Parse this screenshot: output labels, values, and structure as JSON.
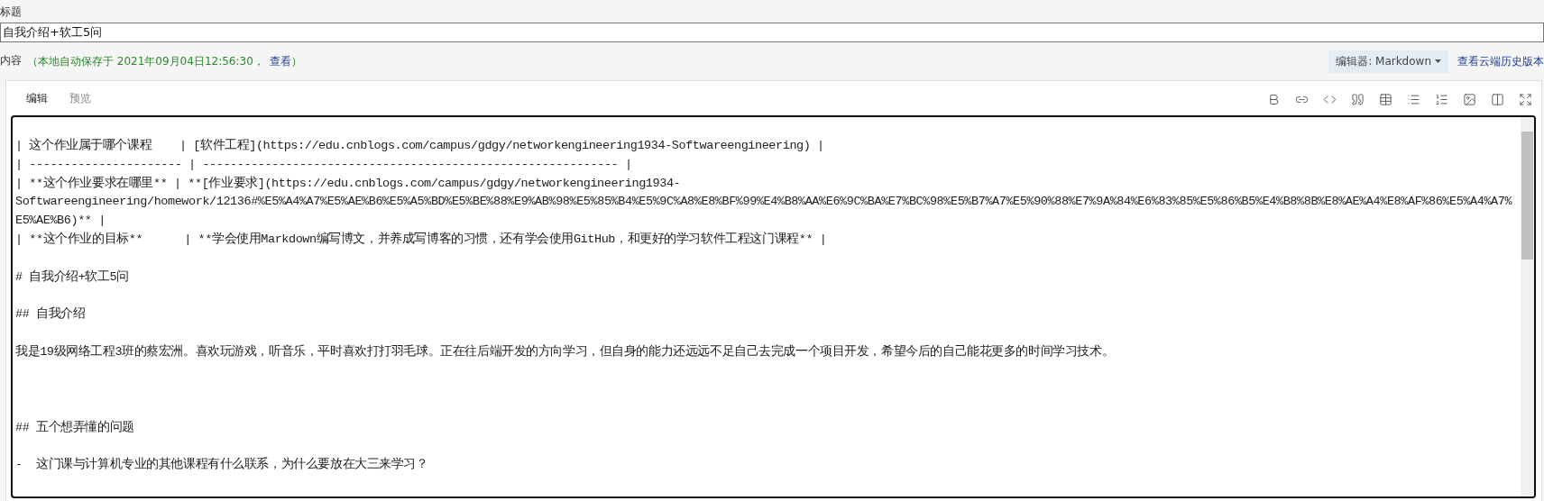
{
  "title_field": {
    "label": "标题",
    "value": "自我介绍+软工5问"
  },
  "content_header": {
    "label": "内容",
    "autosave_note": "（本地自动保存于 2021年09月04日12:56:30，",
    "view_link": "查看",
    "note_end": "）",
    "editor_menu": "编辑器: Markdown",
    "history_link": "查看云端历史版本"
  },
  "tabs": [
    {
      "label": "编辑",
      "selected": true
    },
    {
      "label": "预览",
      "selected": false
    }
  ],
  "toolbar": [
    {
      "kind": "bold"
    },
    {
      "kind": "link"
    },
    {
      "kind": "code"
    },
    {
      "kind": "quote"
    },
    {
      "kind": "table"
    },
    {
      "kind": "list"
    },
    {
      "kind": "ordered-list"
    },
    {
      "kind": "image"
    },
    {
      "kind": "split-view"
    },
    {
      "kind": "fullscreen"
    }
  ],
  "editor": {
    "lines": [
      {
        "kind": "blank"
      },
      {
        "kind": "text",
        "text": "| 这个作业属于哪个课程    | [软件工程](https://edu.cnblogs.com/campus/gdgy/networkengineering1934-Softwareengineering) |"
      },
      {
        "kind": "text",
        "text": "| ---------------------- | ------------------------------------------------------------ |"
      },
      {
        "kind": "text",
        "text": "| **这个作业要求在哪里** | **[作业要求](https://edu.cnblogs.com/campus/gdgy/networkengineering1934-\nSoftwareengineering/homework/12136#%E5%A4%A7%E5%AE%B6%E5%A5%BD%E5%BE%88%E9%AB%98%E5%85%B4%E5%9C%A8%E8%BF%99%E4%B8%AA%E6%9C%BA%E7%BC%98%E5%B7%A7%E5%90%88%E7%9A%84%E6%83%85%E5%86%B5%E4%B8%8B%E8%AE%A4%E8%AF%86%E5%A4%A7%\nE5%AE%B6)** |"
      },
      {
        "kind": "text",
        "text": "| **这个作业的目标**      | **学会使用Markdown编写博文，并养成写博客的习惯，还有学会使用GitHub，和更好的学习软件工程这门课程** |"
      },
      {
        "kind": "blank"
      },
      {
        "kind": "text",
        "text": "# 自我介绍+软工5问"
      },
      {
        "kind": "blank"
      },
      {
        "kind": "text",
        "text": "## 自我介绍"
      },
      {
        "kind": "blank"
      },
      {
        "kind": "text",
        "text": "我是19级网络工程3班的蔡宏洲。喜欢玩游戏，听音乐，平时喜欢打打羽毛球。正在往后端开发的方向学习，但自身的能力还远远不足自己去完成一个项目开发，希望今后的自己能花更多的时间学习技术。"
      },
      {
        "kind": "blank"
      },
      {
        "kind": "blank"
      },
      {
        "kind": "blank"
      },
      {
        "kind": "text",
        "text": "## 五个想弄懂的问题"
      },
      {
        "kind": "blank"
      },
      {
        "kind": "text",
        "text": "-  这门课与计算机专业的其他课程有什么联系，为什么要放在大三来学习？"
      }
    ]
  }
}
